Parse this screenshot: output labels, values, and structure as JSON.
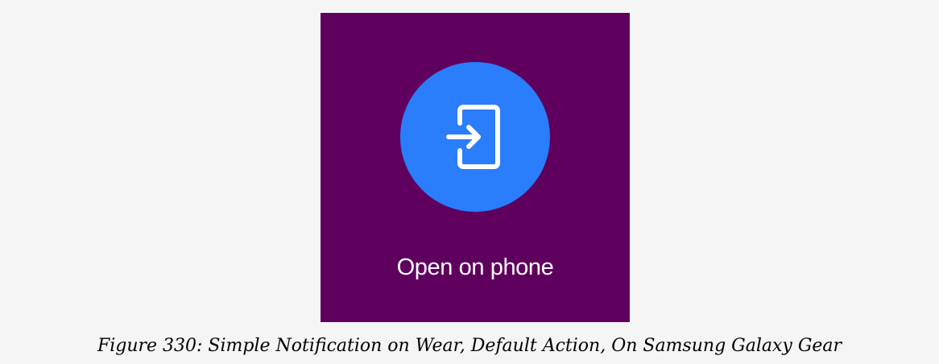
{
  "watch": {
    "background_color": "#5f005f",
    "action": {
      "icon": "open-on-phone-icon",
      "circle_color": "#2a7dfb",
      "label": "Open on phone"
    }
  },
  "figure": {
    "caption": "Figure 330: Simple Notification on Wear, Default Action, On Samsung Galaxy Gear"
  }
}
